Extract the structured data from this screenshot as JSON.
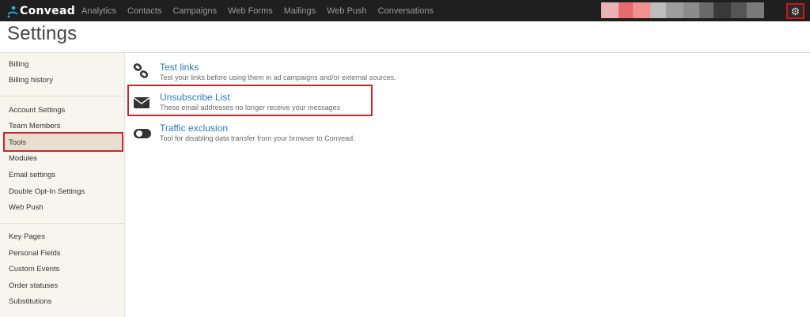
{
  "app": {
    "logo_text": "Convead",
    "nav": [
      "Analytics",
      "Contacts",
      "Campaigns",
      "Web Forms",
      "Mailings",
      "Web Push",
      "Conversations"
    ],
    "user_block_colors": [
      "#e8b3b6",
      "#e46c6f",
      "#f28f8f",
      "#bdbdbd",
      "#9e9e9e",
      "#8c8c8c",
      "#6a6a6a",
      "#3a3a3a",
      "#555555",
      "#7a7a7a"
    ],
    "settings_icon": "gear-icon"
  },
  "page": {
    "title": "Settings"
  },
  "sidebar": {
    "groups": [
      [
        "Billing",
        "Billing history"
      ],
      [
        "Account Settings",
        "Team Members",
        "Tools",
        "Modules",
        "Email settings",
        "Double Opt-In Settings",
        "Web Push"
      ],
      [
        "Key Pages",
        "Personal Fields",
        "Custom Events",
        "Order statuses",
        "Substitutions"
      ]
    ],
    "active": "Tools"
  },
  "tools": [
    {
      "title": "Test links",
      "description": "Test your links before using them in ad campaigns and/or external sources.",
      "icon": "link-icon"
    },
    {
      "title": "Unsubscribe List",
      "description": "These email addresses no longer receive your messages",
      "icon": "envelope-icon"
    },
    {
      "title": "Traffic exclusion",
      "description": "Tool for disabling data transfer from your browser to Convead.",
      "icon": "toggle-icon"
    }
  ],
  "colors": {
    "accent_link": "#2a7bbf",
    "highlight": "#c8262c",
    "topbar": "#1f1f1f"
  }
}
